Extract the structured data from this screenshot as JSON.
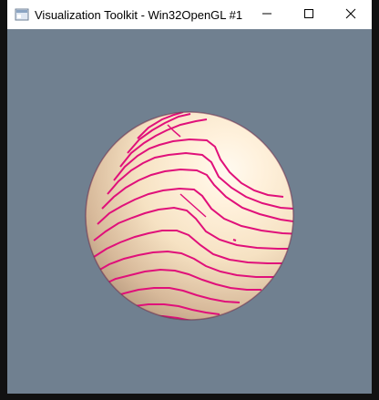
{
  "window": {
    "title": "Visualization Toolkit - Win32OpenGL #1",
    "app_icon": "window-app-icon",
    "controls": {
      "minimize_icon": "minimize-icon",
      "maximize_icon": "maximize-icon",
      "close_icon": "close-icon"
    }
  },
  "scene": {
    "background_color": "#708090",
    "sphere_color": "#f5deb3",
    "contour_color": "#e0107a",
    "sphere_object": "shaded-sphere",
    "contour_lines": "contour-lines"
  }
}
